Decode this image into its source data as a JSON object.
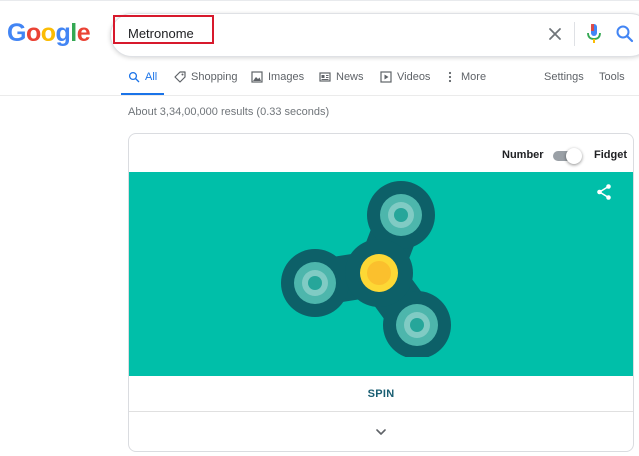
{
  "logo": {
    "letters": [
      "G",
      "o",
      "o",
      "g",
      "l",
      "e"
    ],
    "colors": [
      "#4285f4",
      "#ea4335",
      "#fbbc05",
      "#4285f4",
      "#34a853",
      "#ea4335"
    ]
  },
  "search": {
    "query": "Metronome",
    "icons": [
      "close-icon",
      "microphone-icon",
      "search-icon"
    ]
  },
  "tabs": [
    {
      "label": "All",
      "icon": "search-icon",
      "active": true
    },
    {
      "label": "Shopping",
      "icon": "tag-icon",
      "active": false
    },
    {
      "label": "Images",
      "icon": "image-icon",
      "active": false
    },
    {
      "label": "News",
      "icon": "news-icon",
      "active": false
    },
    {
      "label": "Videos",
      "icon": "play-icon",
      "active": false
    },
    {
      "label": "More",
      "icon": "more-vertical-icon",
      "active": false
    }
  ],
  "tools": {
    "settings": "Settings",
    "tools": "Tools"
  },
  "results_stats": "About 3,34,00,000 results (0.33 seconds)",
  "widget": {
    "mode_left": "Number",
    "mode_right": "Fidget",
    "toggle_on": true,
    "spin_label": "SPIN",
    "colors": {
      "stage": "#00bfa9",
      "spinner_body": "#0d6068",
      "spinner_center": "#fdd835",
      "accent_blue": "#1a73e8",
      "highlight_red": "#d7192c"
    }
  }
}
